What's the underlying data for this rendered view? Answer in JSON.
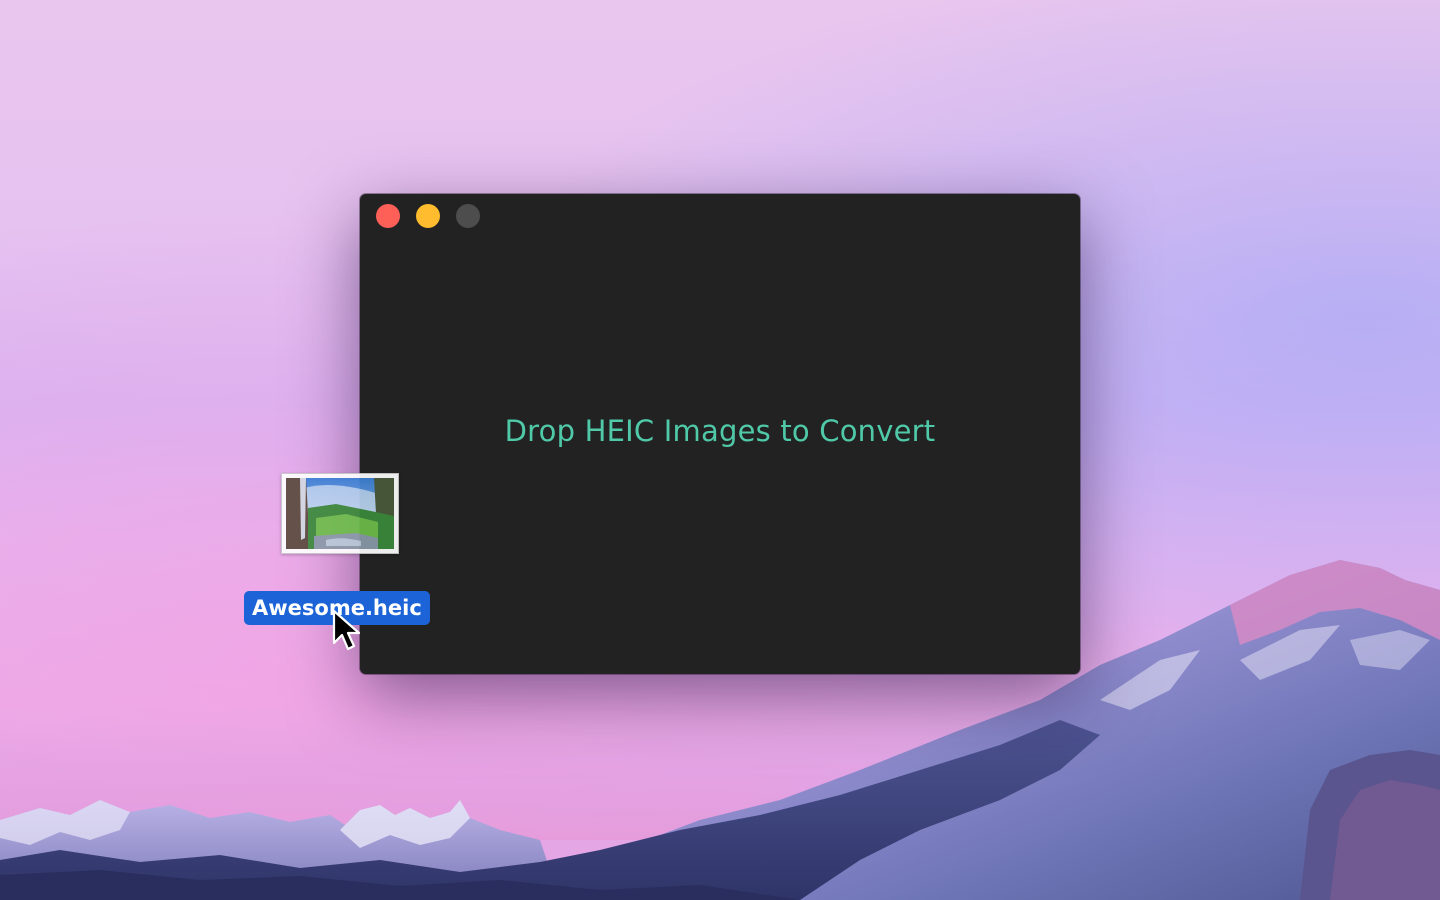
{
  "window": {
    "drop_prompt": "Drop HEIC Images to Convert",
    "traffic_lights": {
      "close_color": "#fe5f57",
      "minimize_color": "#febc2e",
      "zoom_color": "#4d4d4d"
    },
    "accent_color": "#4fc9a8",
    "background_color": "#222222"
  },
  "dragged_file": {
    "name": "Awesome.heic",
    "thumbnail_icon": "image-thumbnail-icon",
    "label_color": "#1c63d8"
  },
  "cursor": {
    "icon": "arrow-pointer-icon"
  }
}
